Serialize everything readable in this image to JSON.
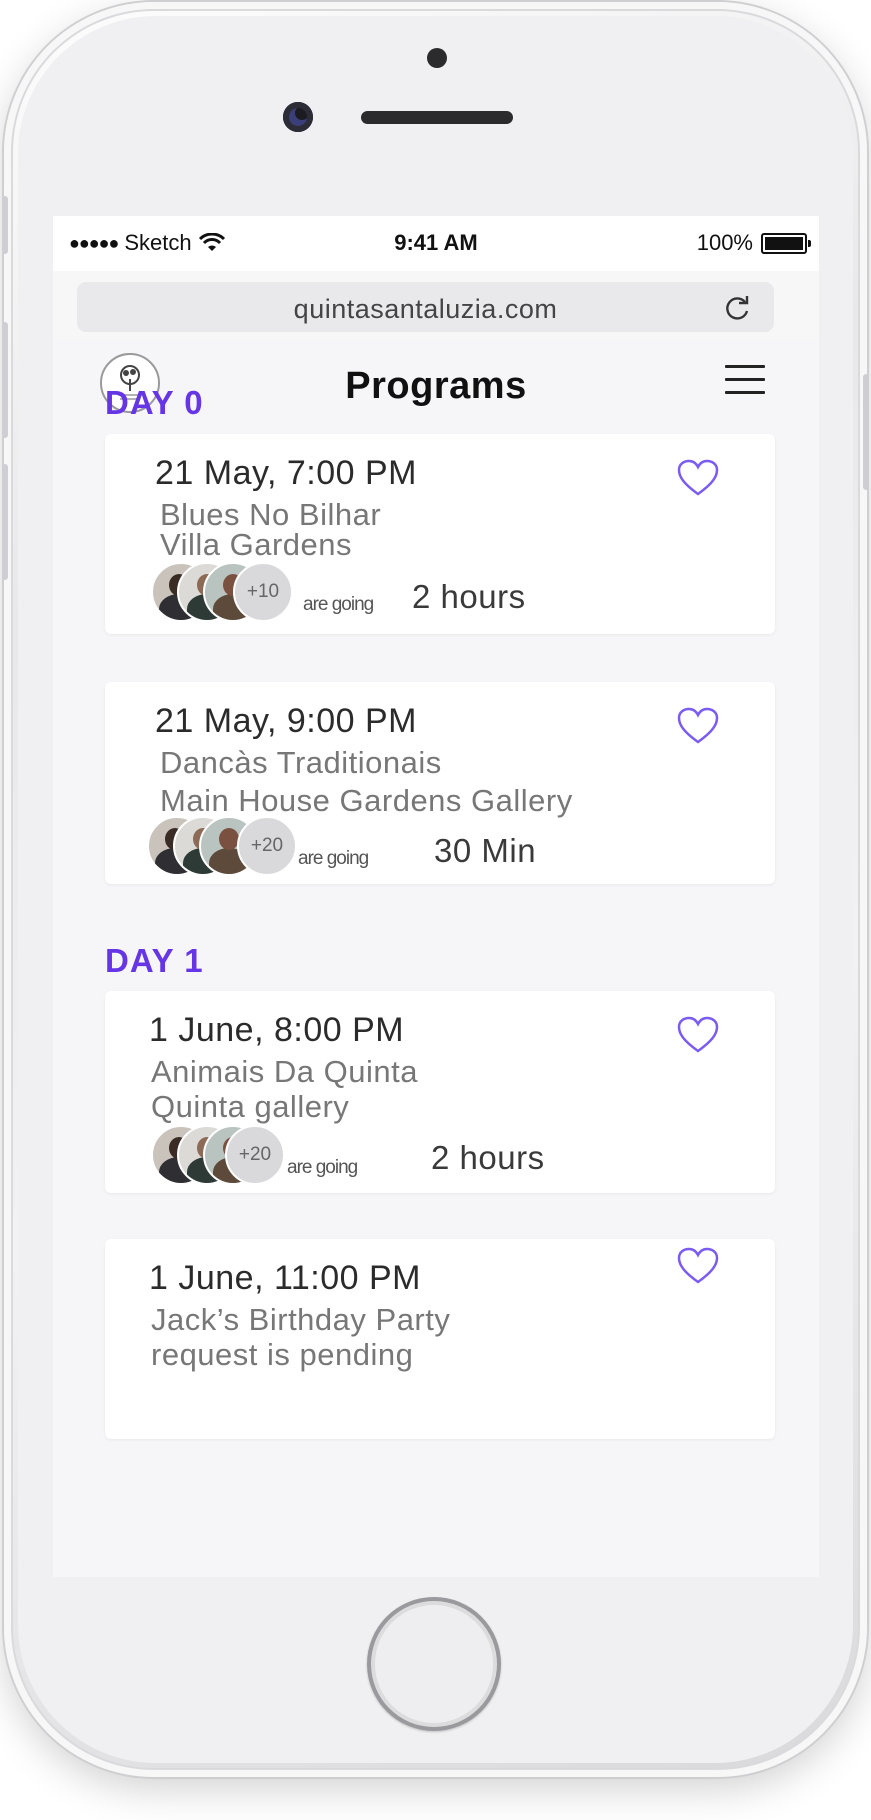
{
  "status_bar": {
    "carrier": "Sketch",
    "time": "9:41 AM",
    "battery": "100%"
  },
  "browser": {
    "url": "quintasantaluzia.com"
  },
  "header": {
    "title": "Programs"
  },
  "days": [
    {
      "label": "DAY 0",
      "events": [
        {
          "datetime": "21 May, 7:00 PM",
          "line1": "Blues No Bilhar",
          "line2": "Villa Gardens",
          "attendees_more": "+10",
          "going": "are going",
          "duration": "2 hours"
        },
        {
          "datetime": "21 May, 9:00 PM",
          "line1": "Dancàs Traditionais",
          "line2": "Main House Gardens Gallery",
          "attendees_more": "+20",
          "going": "are going",
          "duration": "30 Min"
        }
      ]
    },
    {
      "label": "DAY 1",
      "events": [
        {
          "datetime": "1 June, 8:00 PM",
          "line1": "Animais Da Quinta",
          "line2": "Quinta gallery",
          "attendees_more": "+20",
          "going": "are going",
          "duration": "2 hours"
        },
        {
          "datetime": "1 June, 11:00 PM",
          "line1": "Jack’s Birthday Party",
          "line2": "request is pending"
        }
      ]
    }
  ],
  "colors": {
    "accent": "#6535e6",
    "heart": "#7b5cf0"
  }
}
